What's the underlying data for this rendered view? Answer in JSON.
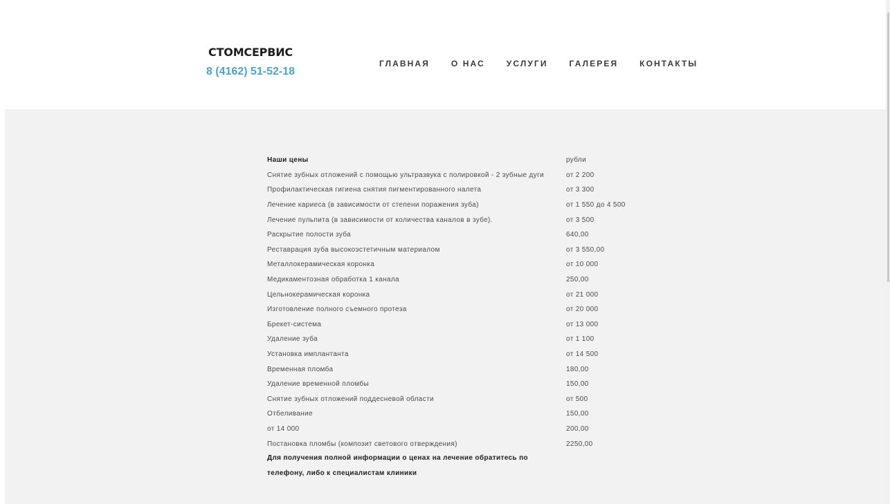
{
  "header": {
    "brand_name": "СТОМСЕРВИС",
    "phone": "8 (4162) 51-52-18",
    "nav": [
      "ГЛАВНАЯ",
      "О НАС",
      "УСЛУГИ",
      "ГАЛЕРЕЯ",
      "КОНТАКТЫ"
    ]
  },
  "prices": {
    "header": {
      "service": "Наши цены",
      "price": "рубли"
    },
    "rows": [
      {
        "service": "Снятие зубных отложений с помощью ультразвука с полировкой - 2 зубные дуги",
        "price": "от 2 200"
      },
      {
        "service": "Профилактическая гигиена снятия пигментированного налета",
        "price": "от 3 300"
      },
      {
        "service": "Лечение кариеса (в зависимости от степени поражения зуба)",
        "price": "от 1 550 до 4 500"
      },
      {
        "service": "Лечение пульпита (в зависимости от количества каналов в зубе).",
        "price": "от 3 500"
      },
      {
        "service": "Раскрытие полости зуба",
        "price": "640,00"
      },
      {
        "service": "Реставрация зуба высокоэстетичным материалом",
        "price": "от 3 550,00"
      },
      {
        "service": "Металлокерамическая коронка",
        "price": "от 10 000"
      },
      {
        "service": "Медикаментозная обработка 1 канала",
        "price": "250,00"
      },
      {
        "service": "Цельнокерамическая коронка",
        "price": "от 21 000"
      },
      {
        "service": "Изготовление полного съемного протеза",
        "price": "от 20 000"
      },
      {
        "service": "Брекет-система",
        "price": "от 13 000"
      },
      {
        "service": "Удаление зуба",
        "price": "от 1 100"
      },
      {
        "service": "Установка имплантанта",
        "price": "от 14 500"
      },
      {
        "service": "Временная пломба",
        "price": "180,00"
      },
      {
        "service": "Удаление временной пломбы",
        "price": "150,00"
      },
      {
        "service": "Снятие зубных отложений поддесневой области",
        "price": "от 500"
      },
      {
        "service": "Отбеливание",
        "price": "150,00"
      },
      {
        "service": "от 14 000",
        "price": "200,00"
      },
      {
        "service": "Постановка пломбы (композит светового отверждения)",
        "price": "2250,00"
      }
    ],
    "note_line1": "Для получения полной информации о ценах на лечение обратитесь по",
    "note_line2": "телефону, либо к специалистам клиники"
  }
}
